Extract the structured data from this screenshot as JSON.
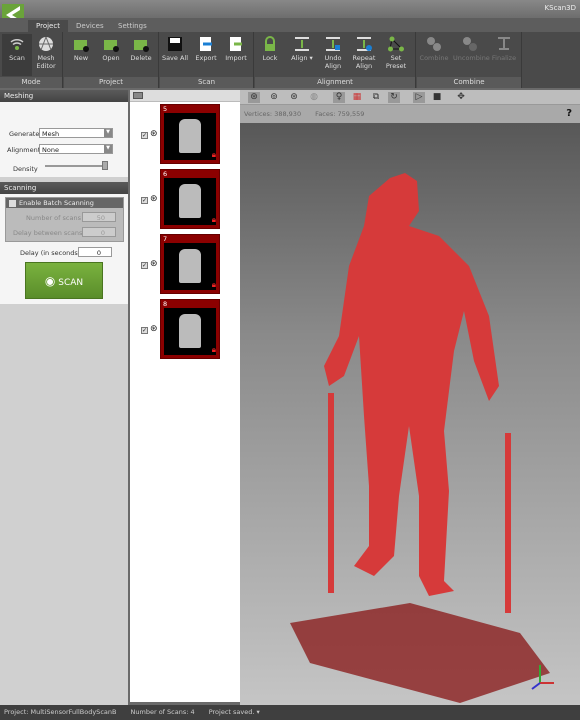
{
  "app": {
    "title": "KScan3D"
  },
  "tabs": [
    {
      "label": "Project"
    },
    {
      "label": "Devices"
    },
    {
      "label": "Settings"
    }
  ],
  "ribbon": {
    "groups": [
      "Mode",
      "Project",
      "Scan",
      "Alignment",
      "Combine"
    ],
    "buttons": {
      "scan": "Scan",
      "mesh_editor": "Mesh Editor",
      "new": "New",
      "open": "Open",
      "delete": "Delete",
      "save_all": "Save All",
      "export": "Export",
      "import": "Import",
      "lock": "Lock",
      "align": "Align ▾",
      "undo_align": "Undo Align",
      "repeat_align": "Repeat Align",
      "set_preset": "Set Preset",
      "combine": "Combine",
      "uncombine": "Uncombine",
      "finalize": "Finalize"
    }
  },
  "meshing": {
    "title": "Meshing",
    "generate_label": "Generate",
    "generate_value": "Mesh",
    "alignment_label": "Alignment",
    "alignment_value": "None",
    "density_label": "Density",
    "density_value": 1.0
  },
  "scanning": {
    "title": "Scanning",
    "batch_label": "Enable Batch Scanning",
    "batch_checked": false,
    "num_scans_label": "Number of scans",
    "num_scans": "50",
    "delay_between_label": "Delay between scans",
    "delay_between": "0",
    "delay_label": "Delay (in seconds)",
    "delay": "0",
    "scan_button": "SCAN"
  },
  "scans": [
    {
      "num": "5",
      "checked": true,
      "locked": true
    },
    {
      "num": "6",
      "checked": true,
      "locked": true
    },
    {
      "num": "7",
      "checked": true,
      "locked": true
    },
    {
      "num": "8",
      "checked": true,
      "locked": true
    }
  ],
  "viewport": {
    "vertices_label": "Vertices:",
    "vertices": "388,930",
    "faces_label": "Faces:",
    "faces": "759,559",
    "help": "?",
    "mesh_color": "#d63a3a"
  },
  "status": {
    "project": "Project:  MultiSensorFullBodyScanB",
    "scans": "Number of Scans:  4",
    "saved": "Project saved. ▾"
  },
  "colors": {
    "accent": "#6aa33a",
    "thumb_border": "#8b0000"
  }
}
